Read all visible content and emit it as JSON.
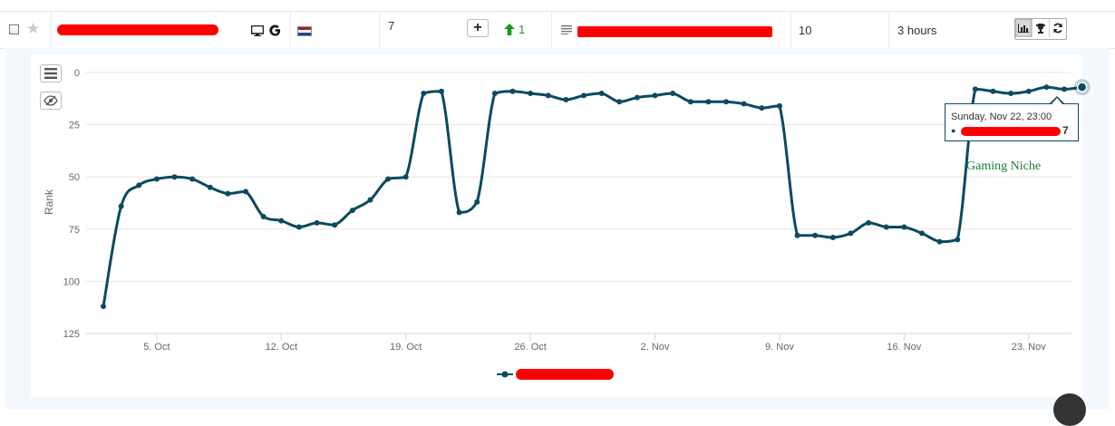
{
  "row": {
    "rank_value": "7",
    "change_value": "1",
    "volume_value": "10",
    "updated_text": "3 hours",
    "search_engine_icon": "google-icon",
    "device_icon": "desktop-icon",
    "flag_colors": [
      "#ae1c28",
      "#ffffff",
      "#21468b"
    ],
    "up_arrow_color": "#1a9a1a"
  },
  "tooltip": {
    "date": "Sunday, Nov 22, 23:00",
    "value": "7"
  },
  "annotation": "Gaming Niche",
  "colors": {
    "series": "#0b4a61",
    "niche_label": "#1a7a3a"
  },
  "chart_data": {
    "type": "line",
    "ylabel": "Rank",
    "y_reversed": true,
    "ylim": [
      0,
      125
    ],
    "y_ticks": [
      "0",
      "25",
      "50",
      "75",
      "100",
      "125"
    ],
    "x_tick_labels": [
      "5. Oct",
      "12. Oct",
      "19. Oct",
      "26. Oct",
      "2. Nov",
      "9. Nov",
      "16. Nov",
      "23. Nov"
    ],
    "grid": true,
    "legend_position": "bottom-center",
    "series": [
      {
        "values": [
          112,
          64,
          54,
          51,
          50,
          51,
          55,
          58,
          57,
          69,
          71,
          74,
          72,
          73,
          66,
          61,
          51,
          50,
          10,
          9,
          67,
          62,
          10,
          9,
          10,
          11,
          13,
          11,
          10,
          14,
          12,
          11,
          10,
          14,
          14,
          14,
          15,
          17,
          16,
          78,
          78,
          79,
          77,
          72,
          74,
          74,
          77,
          81,
          80,
          8,
          9,
          10,
          9,
          7,
          8,
          7
        ]
      }
    ]
  }
}
